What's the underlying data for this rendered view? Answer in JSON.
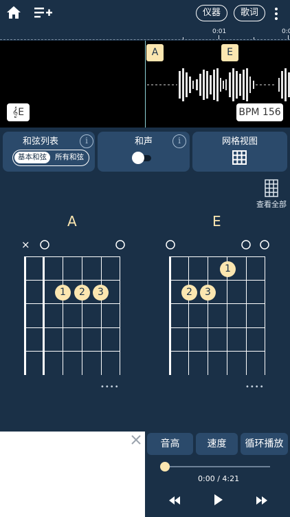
{
  "header": {
    "home_icon": "home-icon",
    "playlist_add_icon": "playlist-add-icon",
    "instrument_label": "仪器",
    "lyrics_label": "歌词",
    "more_icon": "more-vert-icon"
  },
  "timeline": {
    "ticks": [
      "0:01",
      "0:0"
    ]
  },
  "waveform": {
    "chord_tags": [
      "A",
      "E"
    ],
    "key_badge": "E",
    "key_icon": "treble-clef-icon",
    "bpm_label": "BPM 156"
  },
  "panels": {
    "chord_list": {
      "title": "和弦列表",
      "option_basic": "基本和弦",
      "option_all": "所有和弦",
      "info": "i"
    },
    "harmony": {
      "title": "和声",
      "info": "i",
      "toggle_on": false
    },
    "grid_view": {
      "title": "网格视图",
      "icon": "grid-icon"
    }
  },
  "view_all": {
    "label": "查看全部",
    "icon": "grid-icon"
  },
  "chords": [
    {
      "name": "A",
      "open_marks": "× ○ ○",
      "fingers": [
        "1",
        "2",
        "3"
      ],
      "more": "••••"
    },
    {
      "name": "E",
      "open_marks": "○ ○ ○",
      "fingers": [
        "1",
        "2",
        "3"
      ],
      "more": "••••"
    }
  ],
  "controls": {
    "pitch_label": "音高",
    "speed_label": "速度",
    "loop_label": "循环播放",
    "time_display": "0:00 / 4:21",
    "progress": 0.0,
    "close_ad_icon": "close-icon",
    "rewind_icon": "rewind-icon",
    "play_icon": "play-icon",
    "forward_icon": "fast-forward-icon"
  },
  "colors": {
    "background": "#1a3047",
    "panel": "#2b4a6b",
    "accent": "#fbe6b0"
  }
}
